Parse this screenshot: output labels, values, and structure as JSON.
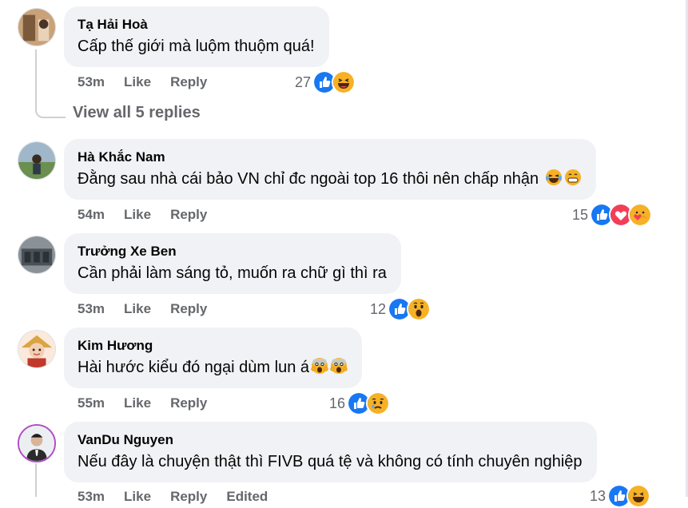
{
  "comments": [
    {
      "author": "Tạ Hải Hoà",
      "text": "Cấp thế giới mà luộm thuộm quá!",
      "time": "53m",
      "like": "Like",
      "reply": "Reply",
      "edited": "",
      "reaction_count": "27",
      "reactions": [
        "like-icon",
        "haha-icon"
      ],
      "text_emojis": []
    },
    {
      "author": "Hà Khắc Nam",
      "text": "Đằng sau nhà cái bảo VN chỉ đc ngoài top 16 thôi nên chấp nhận",
      "time": "54m",
      "like": "Like",
      "reply": "Reply",
      "edited": "",
      "reaction_count": "15",
      "reactions": [
        "like-icon",
        "love-icon",
        "care-icon"
      ],
      "text_emojis": [
        "laughing-tears-emoji",
        "grin-emoji"
      ]
    },
    {
      "author": "Trưởng Xe Ben",
      "text": "Cần phải làm sáng tỏ, muốn ra chữ gì thì ra",
      "time": "53m",
      "like": "Like",
      "reply": "Reply",
      "edited": "",
      "reaction_count": "12",
      "reactions": [
        "like-icon",
        "wow-icon"
      ],
      "text_emojis": []
    },
    {
      "author": "Kim Hương",
      "text": "Hài hước kiểu đó ngại dùm lun á",
      "time": "55m",
      "like": "Like",
      "reply": "Reply",
      "edited": "",
      "reaction_count": "16",
      "reactions": [
        "like-icon",
        "sad-icon"
      ],
      "text_emojis": [
        "scream-emoji",
        "scream-emoji"
      ]
    },
    {
      "author": "VanDu Nguyen",
      "text": "Nếu đây là chuyện thật thì FIVB quá tệ và không có tính chuyên nghiệp",
      "time": "53m",
      "like": "Like",
      "reply": "Reply",
      "edited": "Edited",
      "reaction_count": "13",
      "reactions": [
        "like-icon",
        "haha-icon"
      ],
      "text_emojis": []
    }
  ],
  "view_replies": "View all 5 replies",
  "colors": {
    "like_blue": "#1877f2",
    "love_red": "#f33e58",
    "emoji_yellow": "#f7b125",
    "muted": "#65676b",
    "bubble": "#f0f2f5"
  }
}
